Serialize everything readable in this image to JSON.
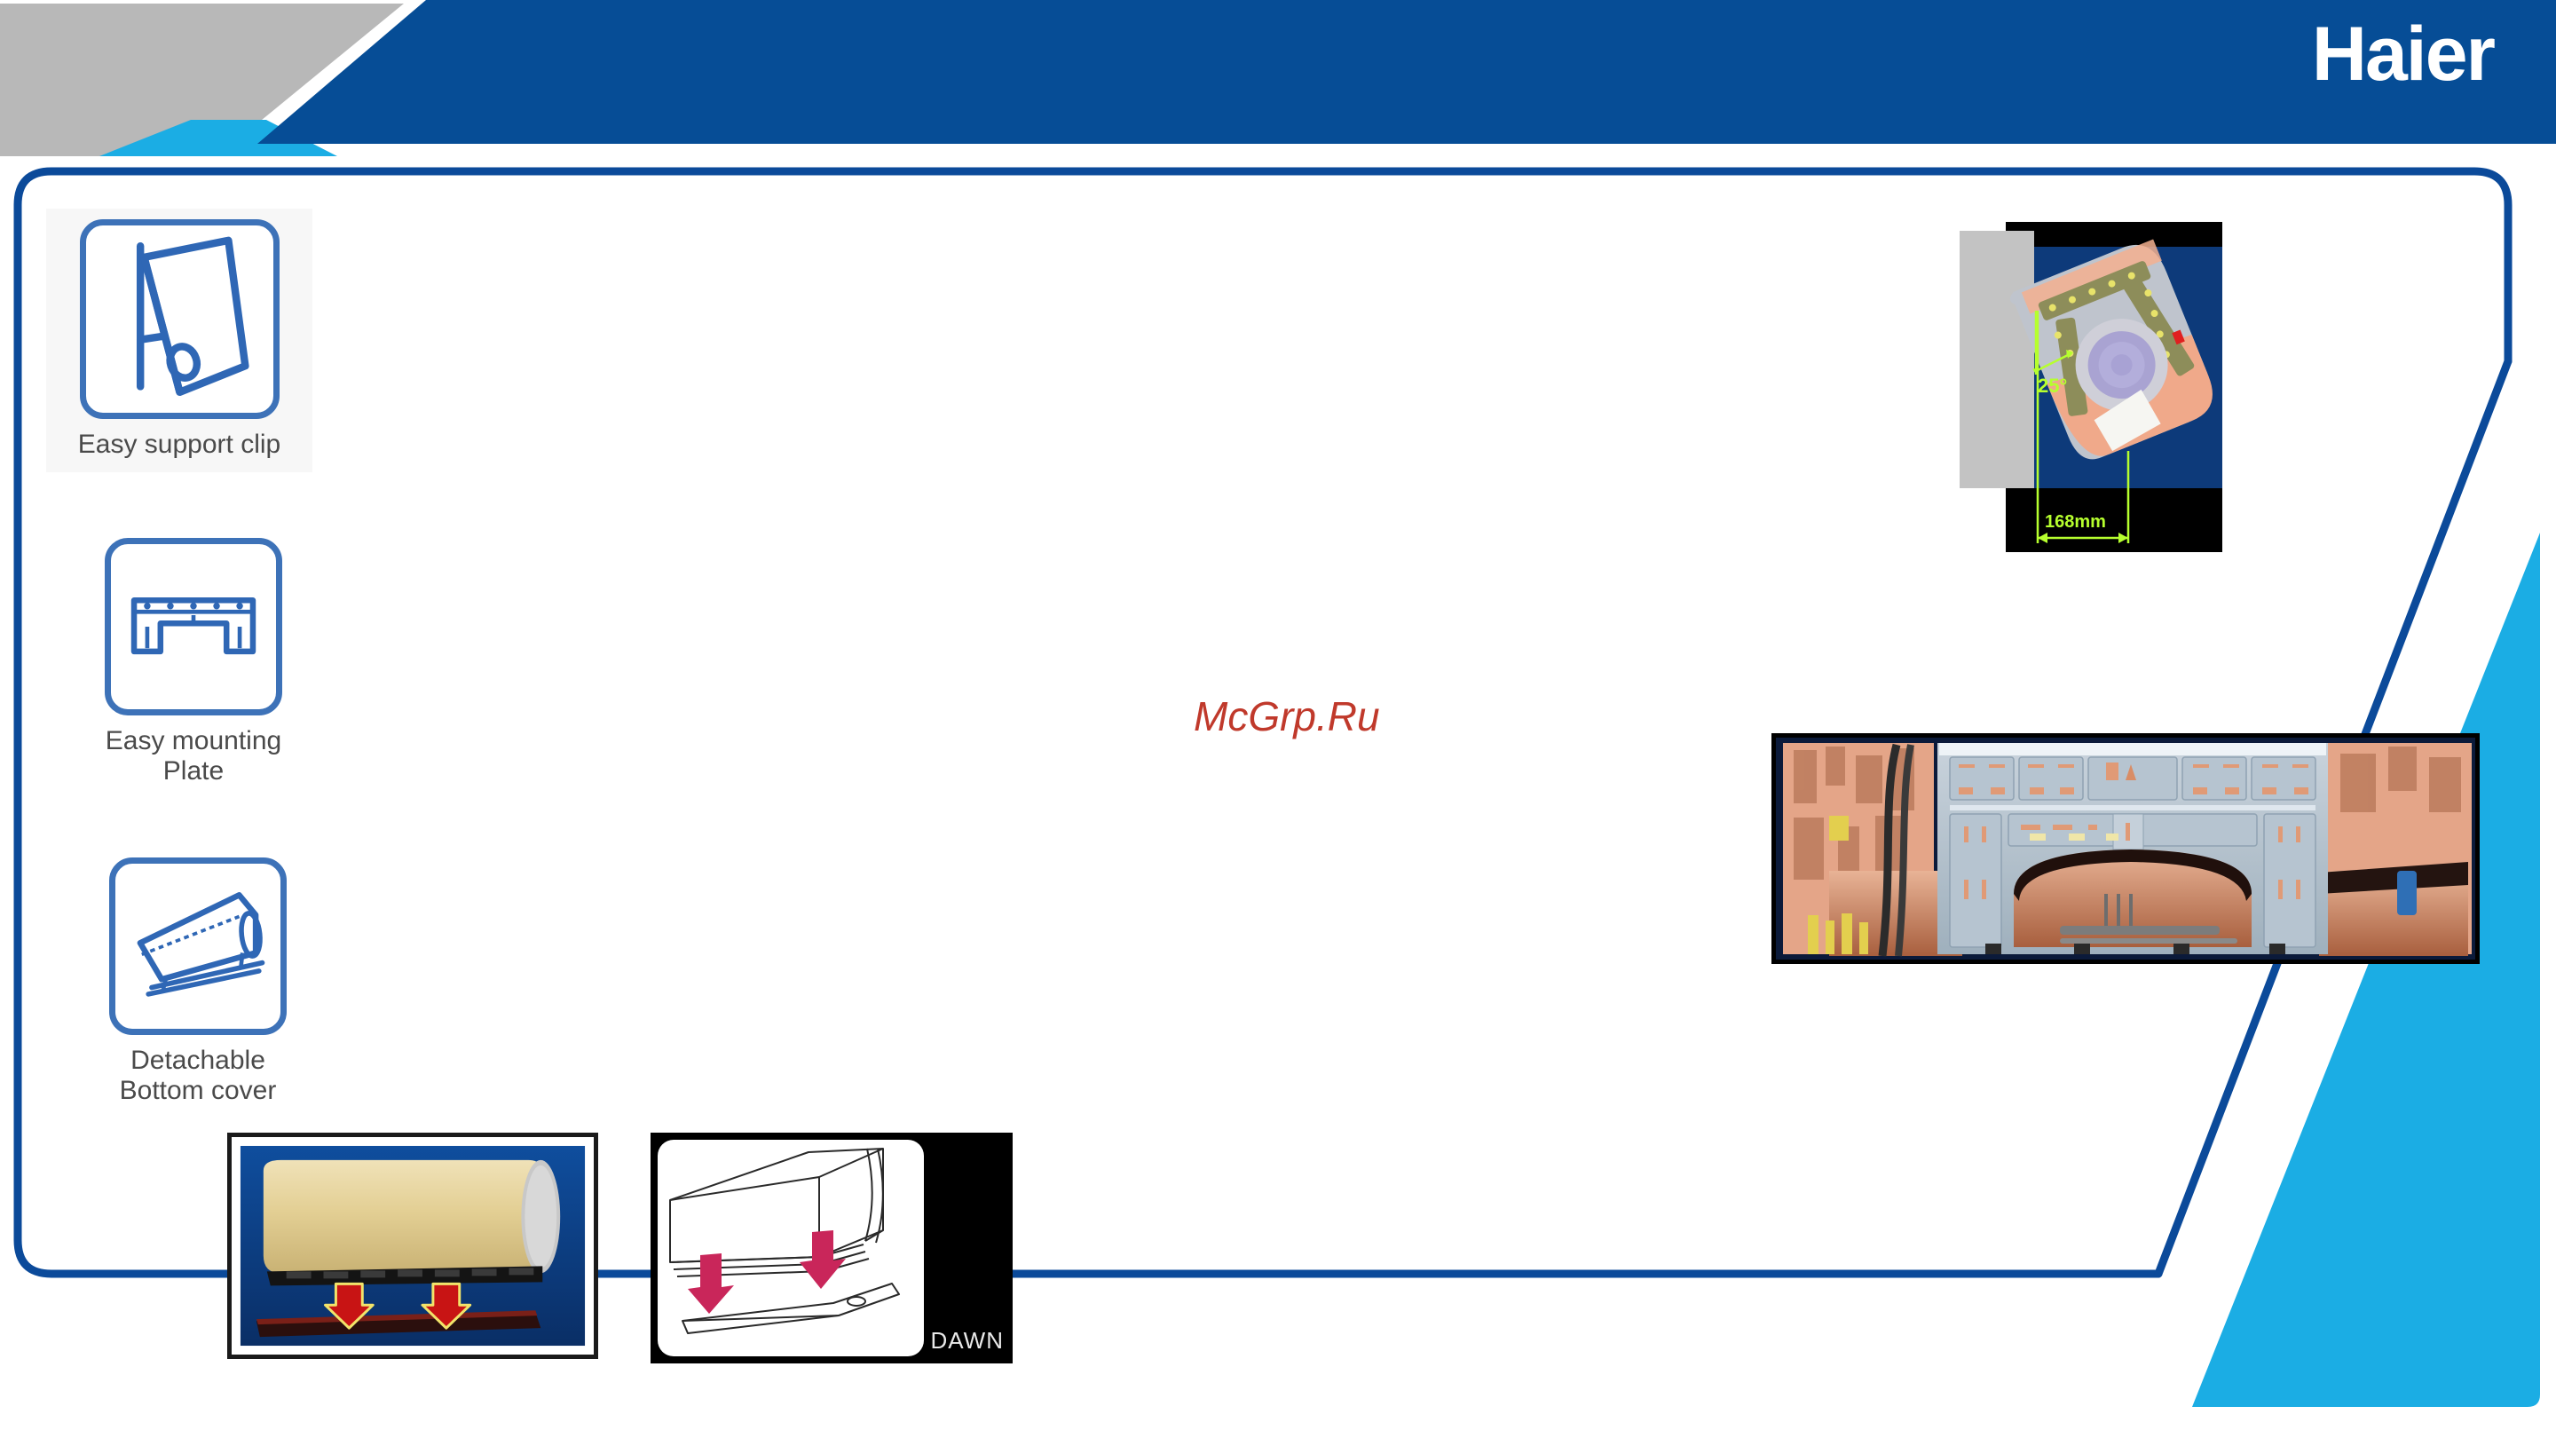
{
  "brand": {
    "logo_text": "Haier",
    "logo_color": "#ffffff",
    "header_navy": "#064D96",
    "header_gray": "#B8B8B8",
    "header_light_blue": "#1BADE4",
    "frame_border_color": "#0b4a9a"
  },
  "features": [
    {
      "id": "easy-support-clip",
      "label": "Easy support clip",
      "icon": "panel-clip-icon"
    },
    {
      "id": "easy-mounting-plate",
      "label": "Easy mounting\nPlate",
      "icon": "mounting-plate-icon"
    },
    {
      "id": "detachable-bottom-cover",
      "label": "Detachable\nBottom cover",
      "icon": "bottom-cover-icon"
    }
  ],
  "watermark": {
    "text": "McGrp.Ru",
    "color": "#c0392b"
  },
  "figures": {
    "cross_section": {
      "name": "unit-cross-section-diagram",
      "angle_label": "25°",
      "depth_label": "168mm",
      "annotation_color": "#b6ff2e"
    },
    "internals": {
      "name": "mounting-plate-internals-photo"
    },
    "render": {
      "name": "bottom-cover-removal-render",
      "arrow_color": "#c81414",
      "arrow_outline": "#f2e46a"
    },
    "line_drawing": {
      "name": "bottom-cover-removal-line-drawing",
      "arrow_color": "#c9265a",
      "caption": "DAWN"
    }
  }
}
